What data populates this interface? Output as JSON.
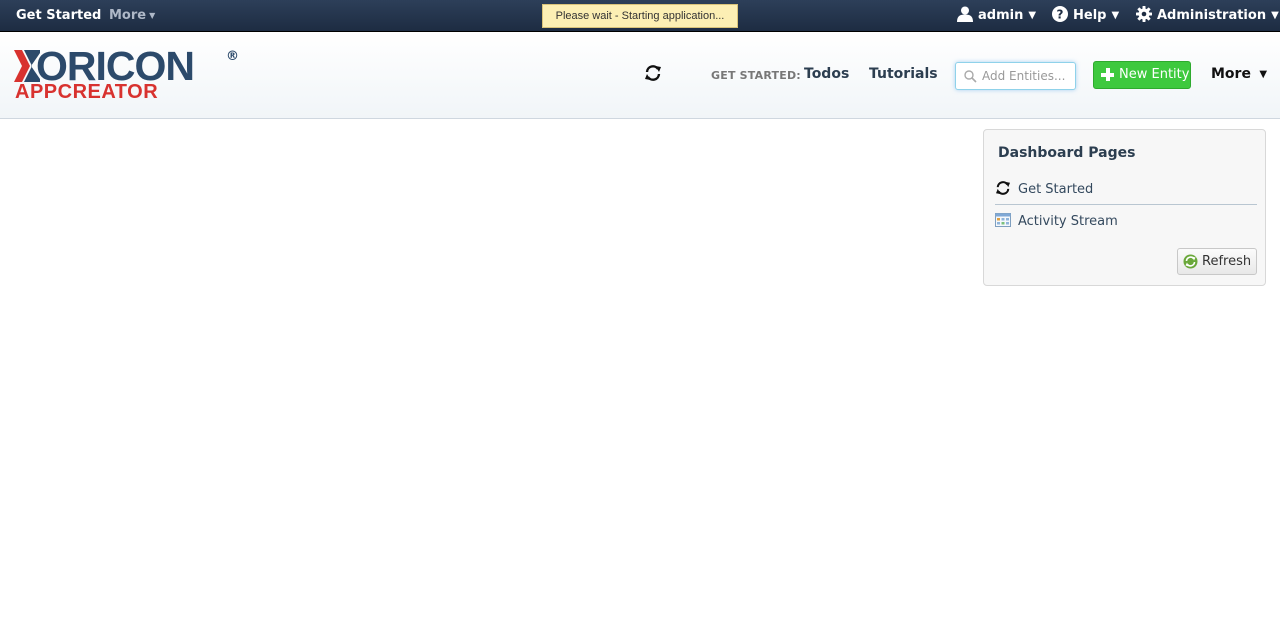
{
  "topbar": {
    "get_started": "Get Started",
    "more": "More",
    "wait_message": "Please wait - Starting application...",
    "user": "admin",
    "help": "Help",
    "administration": "Administration"
  },
  "logo": {
    "main": "ORICON",
    "sub": "APPCREATOR",
    "reg": "®"
  },
  "header": {
    "get_started_label": "GET STARTED:",
    "todos": "Todos",
    "tutorials": "Tutorials",
    "search_placeholder": "Add Entities...",
    "new_entity": "New Entity",
    "more": "More"
  },
  "dashboard": {
    "title": "Dashboard Pages",
    "items": [
      {
        "label": "Get Started",
        "icon": "sync-icon"
      },
      {
        "label": "Activity Stream",
        "icon": "calendar-icon"
      }
    ],
    "refresh": "Refresh"
  },
  "colors": {
    "topbar": "#1d2c42",
    "brand_blue": "#2c4a6b",
    "brand_red": "#d8322f",
    "accent_green": "#3ec93e"
  }
}
